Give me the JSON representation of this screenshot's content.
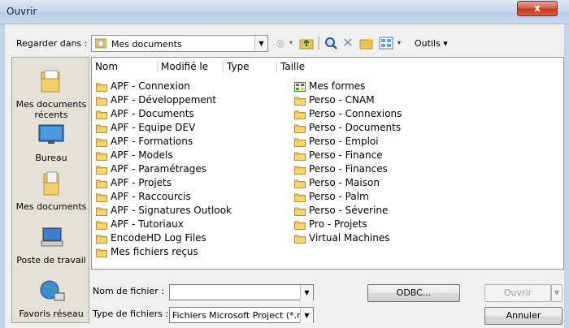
{
  "window": {
    "title": "Ouvrir",
    "close_glyph": "x"
  },
  "toolbar": {
    "look_in_label": "Regarder dans :",
    "look_in_value": "Mes documents",
    "tools_label": "Outils",
    "icons": [
      "back-icon",
      "up-folder-icon",
      "search-web-icon",
      "delete-icon",
      "new-folder-icon",
      "views-icon",
      "tools-menu"
    ]
  },
  "places": [
    {
      "label": "Mes documents récents",
      "icon": "recent-documents-icon"
    },
    {
      "label": "Bureau",
      "icon": "desktop-icon"
    },
    {
      "label": "Mes documents",
      "icon": "my-documents-icon"
    },
    {
      "label": "Poste de travail",
      "icon": "my-computer-icon"
    },
    {
      "label": "Favoris réseau",
      "icon": "network-places-icon"
    }
  ],
  "columns": [
    "Nom",
    "Modifié le",
    "Type",
    "Taille"
  ],
  "files_col1": [
    "APF - Connexion",
    "APF - Développement",
    "APF - Documents",
    "APF - Equipe DEV",
    "APF - Formations",
    "APF - Models",
    "APF - Paramétrages",
    "APF - Projets",
    "APF - Raccourcis",
    "APF - Signatures Outlook",
    "APF - Tutoriaux",
    "EncodeHD Log Files",
    "Mes fichiers reçus"
  ],
  "files_col2": [
    "Mes formes",
    "Perso - CNAM",
    "Perso - Connexions",
    "Perso - Documents",
    "Perso - Emploi",
    "Perso - Finance",
    "Perso - Finances",
    "Perso - Maison",
    "Perso - Palm",
    "Perso - Séverine",
    "Pro - Projets",
    "Virtual Machines"
  ],
  "bottom": {
    "filename_label": "Nom de fichier :",
    "filename_value": "",
    "filetype_label": "Type de fichiers :",
    "filetype_value": "Fichiers Microsoft Project (*.mp*",
    "odbc_label": "ODBC...",
    "open_label": "Ouvrir",
    "cancel_label": "Annuler"
  },
  "colors": {
    "folder": "#e8c35a",
    "title_bar": "#c6d6ec",
    "close": "#c2391c"
  }
}
